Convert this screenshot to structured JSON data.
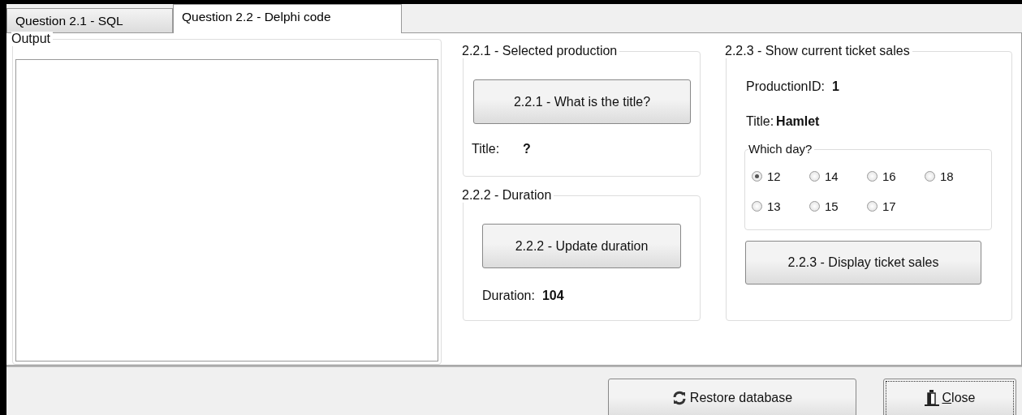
{
  "tabs": [
    {
      "label": "Question 2.1 - SQL",
      "selected": false
    },
    {
      "label": "Question 2.2 - Delphi code",
      "selected": true
    }
  ],
  "output": {
    "legend": "Output"
  },
  "selected_production": {
    "legend": "2.2.1 - Selected production",
    "button": "2.2.1 - What is the title?",
    "label": "Title:",
    "value": "?"
  },
  "duration": {
    "legend": "2.2.2 - Duration",
    "button": "2.2.2 - Update duration",
    "label": "Duration:",
    "value": "104"
  },
  "ticket_sales": {
    "legend": "2.2.3 - Show current ticket sales",
    "production_label": "ProductionID:",
    "production_value": "1",
    "title_label": "Title:",
    "title_value": "Hamlet",
    "day_group": "Which day?",
    "days": [
      {
        "label": "12",
        "selected": true
      },
      {
        "label": "14",
        "selected": false
      },
      {
        "label": "16",
        "selected": false
      },
      {
        "label": "18",
        "selected": false
      },
      {
        "label": "13",
        "selected": false
      },
      {
        "label": "15",
        "selected": false
      },
      {
        "label": "17",
        "selected": false
      }
    ],
    "button": "2.2.3 - Display ticket sales"
  },
  "footer_buttons": [
    {
      "kind": "restore",
      "label": "Restore database"
    },
    {
      "kind": "close",
      "label": "Close"
    }
  ]
}
